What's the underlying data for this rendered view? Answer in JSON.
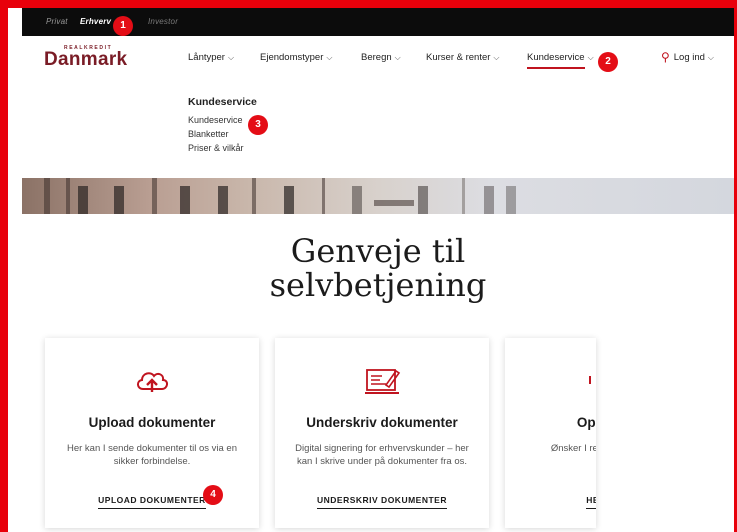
{
  "topbar": {
    "segments": [
      "Privat",
      "Erhverv",
      "Investor"
    ]
  },
  "brand": {
    "sup": "REALKREDIT",
    "name": "Danmark"
  },
  "nav": {
    "items": [
      "Låntyper",
      "Ejendomstyper",
      "Beregn",
      "Kurser & renter",
      "Kundeservice"
    ],
    "login": "Log ind"
  },
  "dropdown": {
    "title": "Kundeservice",
    "links": [
      "Kundeservice",
      "Blanketter",
      "Priser & vilkår"
    ]
  },
  "headline": {
    "line1": "Genveje til",
    "line2": "selvbetjening"
  },
  "cards": [
    {
      "icon": "cloud-upload-icon",
      "title": "Upload dokumenter",
      "desc": "Her kan I sende dokumenter til os via en sikker forbindelse.",
      "action": "UPLOAD DOKUMENTER"
    },
    {
      "icon": "document-sign-icon",
      "title": "Underskriv dokumenter",
      "desc": "Digital signering for erhvervskunder – her kan I skrive under på dokumenter fra os.",
      "action": "UNDERSKRIV DOKUMENTER"
    },
    {
      "icon": "cancel-icon",
      "title": "Opsig",
      "desc": "Ønsker I realkreditlån",
      "action": "HEN"
    }
  ],
  "badges": [
    "1",
    "2",
    "3",
    "4"
  ],
  "colors": {
    "frame": "#e8000b",
    "brand": "#7a1c26",
    "accent": "#c0141f",
    "badge": "#e40d16"
  }
}
